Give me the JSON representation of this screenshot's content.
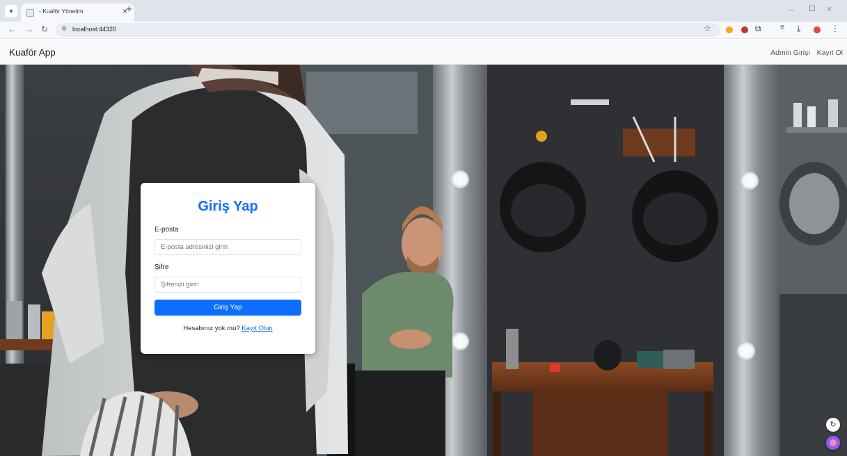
{
  "browser": {
    "tab_title": "- Kuaför Yönetim",
    "url": "localhost:44320",
    "icons": [
      "tab-search-icon",
      "page-favicon-icon",
      "tab-close-icon",
      "new-tab-icon",
      "back-icon",
      "forward-icon",
      "reload-icon",
      "site-info-icon",
      "bookmark-star-icon",
      "extension-icon",
      "menu-icon",
      "minimize-icon",
      "maximize-icon",
      "close-window-icon"
    ]
  },
  "navbar": {
    "brand": "Kuaför App",
    "links": [
      "Admin Girişi",
      "Kayıt Ol"
    ]
  },
  "hero": {
    "description_icon": "barbershop-photo"
  },
  "login": {
    "title": "Giriş Yap",
    "email_label": "E-posta",
    "email_placeholder": "E-posta adresinizi girin",
    "password_label": "Şifre",
    "password_placeholder": "Şifrenizi girin",
    "submit_label": "Giriş Yap",
    "no_account_text": "Hesabınız yok mu?",
    "register_link": "Kayıt Olun"
  },
  "colors": {
    "primary": "#0d6efd",
    "navbar_bg": "#f8f9fa"
  }
}
